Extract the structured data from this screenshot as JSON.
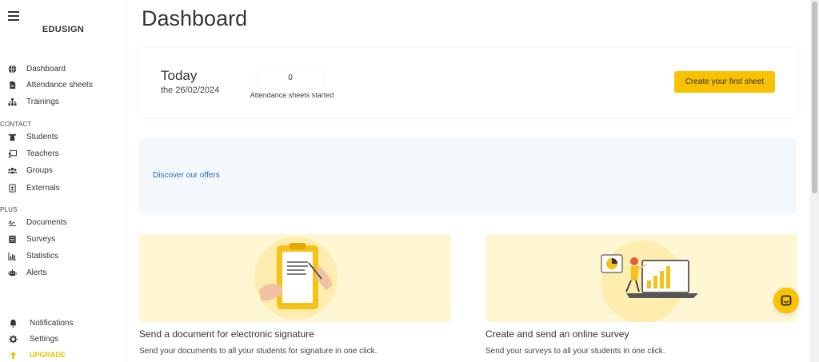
{
  "sidebar": {
    "brand": "EDUSIGN",
    "main_items": [
      {
        "label": "Dashboard",
        "icon": "globe-icon"
      },
      {
        "label": "Attendance sheets",
        "icon": "document-icon"
      },
      {
        "label": "Trainings",
        "icon": "hierarchy-icon"
      }
    ],
    "contact_label": "CONTACT",
    "contact_items": [
      {
        "label": "Students",
        "icon": "graduation-cap-icon"
      },
      {
        "label": "Teachers",
        "icon": "teacher-board-icon"
      },
      {
        "label": "Groups",
        "icon": "users-icon"
      },
      {
        "label": "Externals",
        "icon": "id-card-icon"
      }
    ],
    "plus_label": "PLUS",
    "plus_items": [
      {
        "label": "Documents",
        "icon": "signature-icon"
      },
      {
        "label": "Surveys",
        "icon": "list-icon"
      },
      {
        "label": "Statistics",
        "icon": "bar-chart-icon"
      },
      {
        "label": "Alerts",
        "icon": "robot-icon"
      }
    ],
    "bottom_items": [
      {
        "label": "Notifications",
        "icon": "bell-icon"
      },
      {
        "label": "Settings",
        "icon": "gear-icon"
      },
      {
        "label": "UPGRADE",
        "icon": "arrow-up-icon"
      }
    ]
  },
  "main": {
    "title": "Dashboard",
    "today": {
      "title": "Today",
      "date": "the 26/02/2024",
      "count": "0",
      "count_label": "Attendance sheets started",
      "create_button": "Create your first sheet"
    },
    "offers_link": "Discover our offers",
    "features": [
      {
        "title": "Send a document for electronic signature",
        "description": "Send your documents to all your students for signature in one click."
      },
      {
        "title": "Create and send an online survey",
        "description": "Send your surveys to all your students in one click."
      }
    ]
  },
  "colors": {
    "accent": "#f9c200",
    "upgrade": "#e8c100",
    "link": "#2b6aa6",
    "offers_bg": "#f3f8fc",
    "card_bg": "#fff7d4"
  }
}
